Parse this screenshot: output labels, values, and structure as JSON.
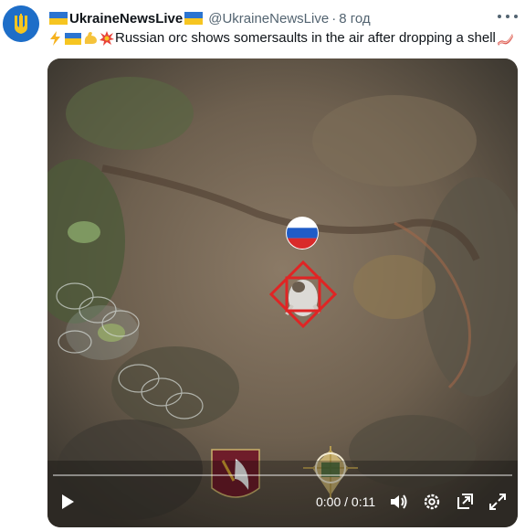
{
  "account": {
    "display_name": "UkraineNewsLive",
    "handle": "@UkraineNewsLive",
    "separator": "·",
    "time_ago": "8 год"
  },
  "tweet": {
    "text": "Russian orc shows somersaults in the air after dropping a shell",
    "leading_emojis": [
      "lightning-emoji",
      "ukraine-flag-emoji",
      "flexed-biceps-emoji",
      "collision-emoji"
    ],
    "trailing_emoji": "bacon-emoji"
  },
  "video": {
    "current_time": "0:00",
    "time_separator": "/",
    "duration": "0:11",
    "progress_fraction": 0.0,
    "controls": [
      "play-icon",
      "volume-icon",
      "settings-icon",
      "pip-icon",
      "fullscreen-icon"
    ]
  },
  "colors": {
    "flag_blue": "#2b74d0",
    "flag_yellow": "#f6c521",
    "text_secondary": "#536471",
    "target_box": "#e02424"
  }
}
